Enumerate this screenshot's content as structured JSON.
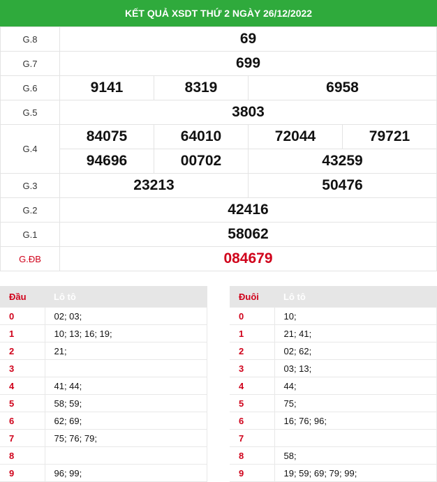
{
  "title": "KẾT QUẢ XSDT THỨ 2 NGÀY 26/12/2022",
  "prizes": {
    "g8": {
      "label": "G.8",
      "values": [
        "69"
      ]
    },
    "g7": {
      "label": "G.7",
      "values": [
        "699"
      ]
    },
    "g6": {
      "label": "G.6",
      "values": [
        "9141",
        "8319",
        "6958"
      ]
    },
    "g5": {
      "label": "G.5",
      "values": [
        "3803"
      ]
    },
    "g4": {
      "label": "G.4",
      "values": [
        "84075",
        "64010",
        "72044",
        "79721",
        "94696",
        "00702",
        "43259"
      ]
    },
    "g3": {
      "label": "G.3",
      "values": [
        "23213",
        "50476"
      ]
    },
    "g2": {
      "label": "G.2",
      "values": [
        "42416"
      ]
    },
    "g1": {
      "label": "G.1",
      "values": [
        "58062"
      ]
    },
    "db": {
      "label": "G.ĐB",
      "values": [
        "084679"
      ]
    }
  },
  "dau_table": {
    "head_key": "Đầu",
    "head_val": "Lô tô",
    "rows": [
      {
        "key": "0",
        "val": "02; 03;"
      },
      {
        "key": "1",
        "val": "10; 13; 16; 19;"
      },
      {
        "key": "2",
        "val": "21;"
      },
      {
        "key": "3",
        "val": ""
      },
      {
        "key": "4",
        "val": "41; 44;"
      },
      {
        "key": "5",
        "val": "58; 59;"
      },
      {
        "key": "6",
        "val": "62; 69;"
      },
      {
        "key": "7",
        "val": "75; 76; 79;"
      },
      {
        "key": "8",
        "val": ""
      },
      {
        "key": "9",
        "val": "96; 99;"
      }
    ]
  },
  "duoi_table": {
    "head_key": "Đuôi",
    "head_val": "Lô tô",
    "rows": [
      {
        "key": "0",
        "val": "10;"
      },
      {
        "key": "1",
        "val": "21; 41;"
      },
      {
        "key": "2",
        "val": "02; 62;"
      },
      {
        "key": "3",
        "val": "03; 13;"
      },
      {
        "key": "4",
        "val": "44;"
      },
      {
        "key": "5",
        "val": "75;"
      },
      {
        "key": "6",
        "val": "16; 76; 96;"
      },
      {
        "key": "7",
        "val": ""
      },
      {
        "key": "8",
        "val": "58;"
      },
      {
        "key": "9",
        "val": "19; 59; 69; 79; 99;"
      }
    ]
  }
}
